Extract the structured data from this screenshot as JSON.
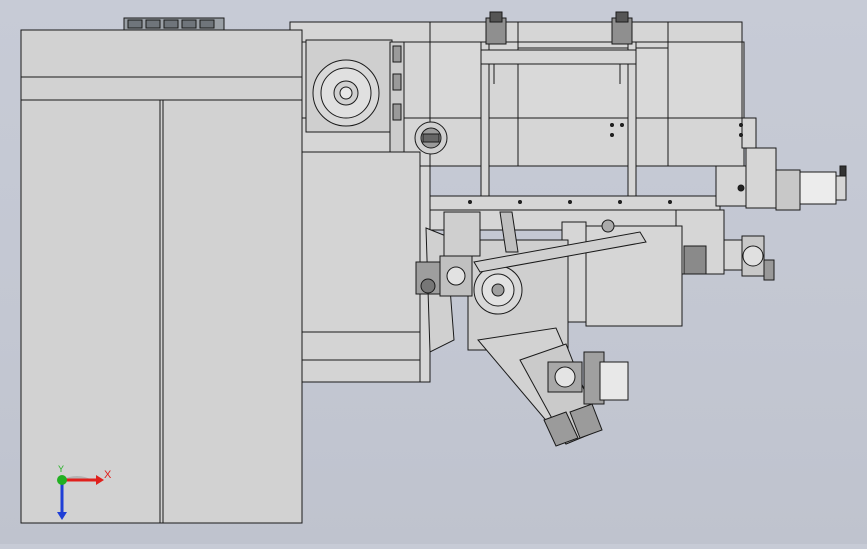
{
  "viewport": {
    "background_top": "#c7cbd6",
    "background_bottom": "#bfc3ce",
    "part_fill": "#d4d4d4",
    "part_fill_light": "#dcdcdc",
    "edge_color": "#1a1a1a"
  },
  "triad": {
    "x_label": "X",
    "y_label": "Y",
    "x_color": "#e0201c",
    "y_color": "#22b022",
    "z_color": "#1f3fd6"
  }
}
